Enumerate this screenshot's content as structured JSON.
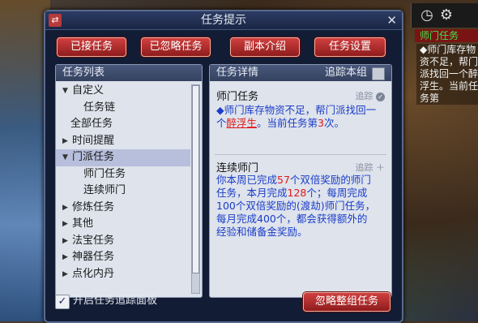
{
  "hud": {
    "side_tag": "师门任务",
    "side_text": "◆师门库存物资不足，帮门派找回一个醉浮生。当前任务第"
  },
  "dialog": {
    "title": "任务提示",
    "buttons": [
      "已接任务",
      "已忽略任务",
      "副本介绍",
      "任务设置"
    ],
    "list_header": "任务列表",
    "list_items": [
      {
        "label": "自定义",
        "expand": "down",
        "indent": 1
      },
      {
        "label": "任务链",
        "expand": "",
        "indent": 2
      },
      {
        "label": "全部任务",
        "expand": "",
        "indent": 0
      },
      {
        "label": "时间提醒",
        "expand": "right",
        "indent": 1
      },
      {
        "label": "门派任务",
        "expand": "down",
        "indent": 1,
        "selected": true
      },
      {
        "label": "师门任务",
        "expand": "",
        "indent": 2
      },
      {
        "label": "连续师门",
        "expand": "",
        "indent": 2
      },
      {
        "label": "修炼任务",
        "expand": "right",
        "indent": 1
      },
      {
        "label": "其他",
        "expand": "right",
        "indent": 1
      },
      {
        "label": "法宝任务",
        "expand": "right",
        "indent": 1
      },
      {
        "label": "神器任务",
        "expand": "right",
        "indent": 1
      },
      {
        "label": "点化内丹",
        "expand": "right",
        "indent": 1
      }
    ],
    "detail_header": "任务详情",
    "track_group_label": "追踪本组",
    "task1": {
      "title": "师门任务",
      "track": "追踪",
      "text_parts": [
        "◆师门库存物资不足，帮门派找回一个",
        "醉浮生",
        "。当前任务第",
        "3",
        "次。"
      ]
    },
    "task2": {
      "title": "连续师门",
      "track": "追踪",
      "text_parts": [
        "你本周已完成",
        "57",
        "个双倍奖励的师门任务，本月完成",
        "128",
        "个；每周完成100个双倍奖励的(渡劫)师门任务，每月完成400个，都会获得额外的经验和储备金奖励。"
      ]
    },
    "checkbox_label": "开启任务追踪面板",
    "ignore_group_button": "忽略整组任务"
  },
  "colors": {
    "accent_red": "#e01818",
    "text_blue": "#1a3cc8",
    "button_red": "#b52a2a"
  }
}
